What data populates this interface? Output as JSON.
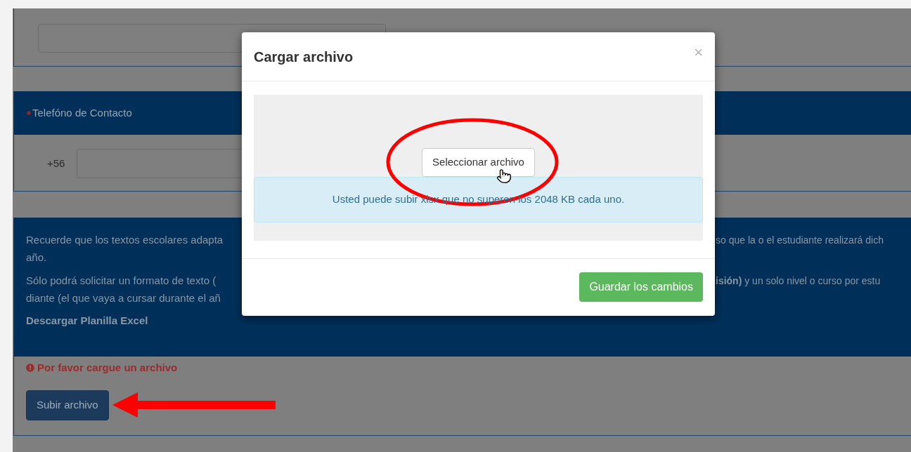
{
  "phone_section": {
    "label": "Telefóno de Contacto",
    "prefix": "+56"
  },
  "info_section": {
    "paragraphs": [
      {
        "lines": [
          {
            "left": "Recuerde que los textos escolares adapta",
            "right": "so que la o el estudiante realizará dich"
          },
          {
            "left": "año."
          }
        ]
      },
      {
        "lines": [
          {
            "left": "Sólo podrá solicitar un formato de texto (",
            "right": "**isión)** y un solo nivel o curso por estu"
          },
          {
            "left": "diante (el que vaya a cursar durante el añ"
          }
        ]
      }
    ],
    "download_link": "Descargar Planilla Excel",
    "error": "Por favor cargue un archivo",
    "upload_button": "Subir archivo"
  },
  "modal": {
    "title": "Cargar archivo",
    "close": "×",
    "select_button": "Seleccionar archivo",
    "alert": "Usted puede subir xlsx que no superen los 2048 KB cada uno.",
    "save_button": "Guardar los cambios"
  }
}
